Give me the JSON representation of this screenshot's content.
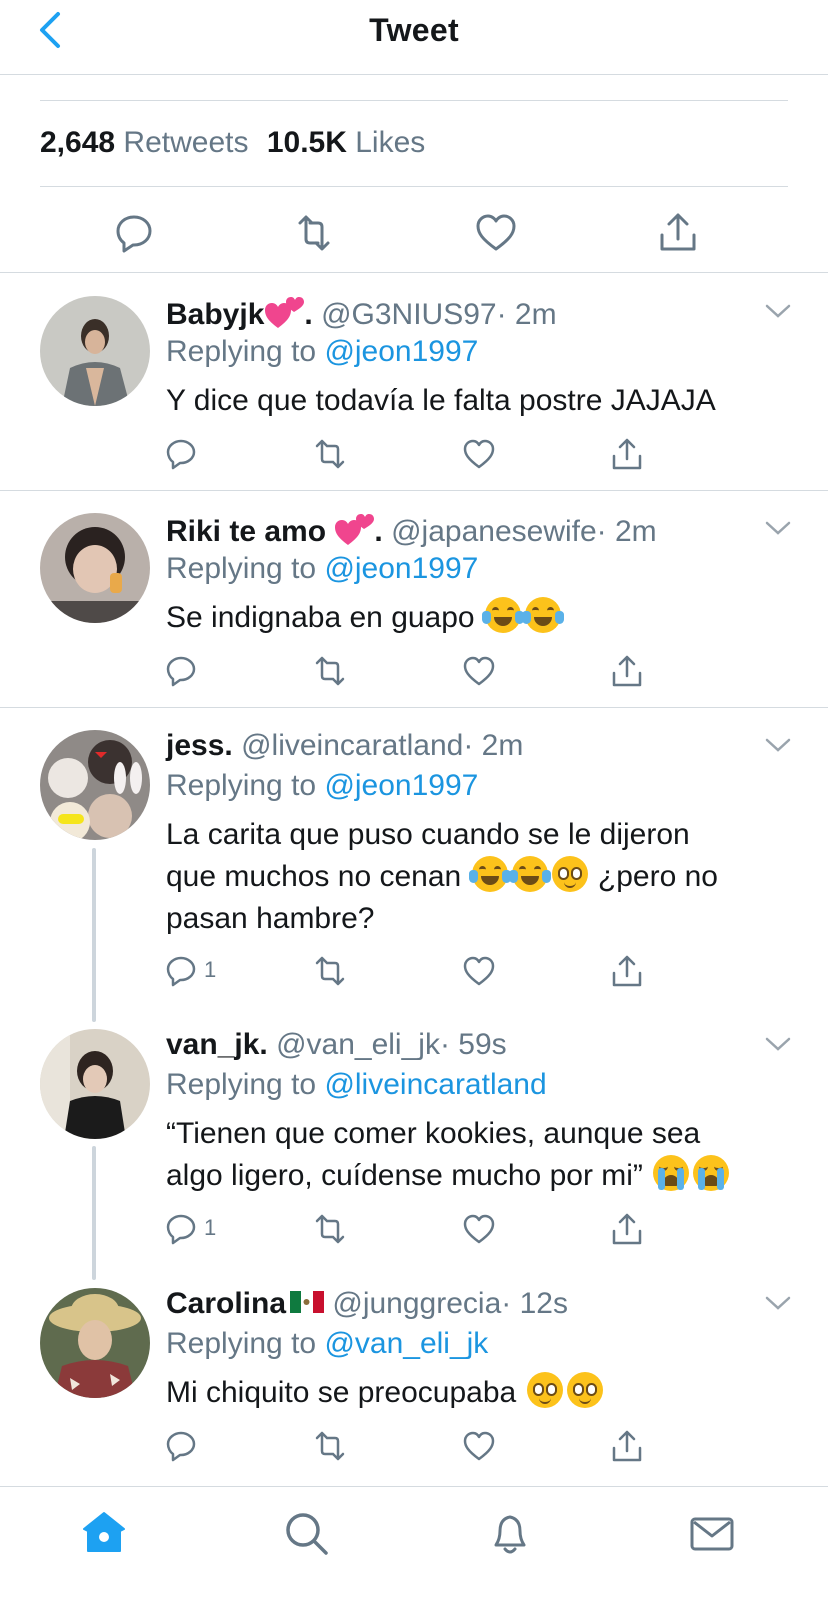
{
  "header": {
    "title": "Tweet",
    "back_icon": "chevron-left-icon"
  },
  "stats": {
    "retweets_count": "2,648",
    "retweets_label": "Retweets",
    "likes_count": "10.5K",
    "likes_label": "Likes"
  },
  "colors": {
    "accent": "#1da1f2",
    "link": "#1b95e0",
    "muted": "#657786",
    "divider": "#d5dbe0"
  },
  "replies": [
    {
      "name": "Babyjk",
      "name_suffix": ".",
      "handle": "@G3NIUS97",
      "time": "· 2m",
      "replying_prefix": "Replying to",
      "replying_to": "@jeon1997",
      "text": "Y dice que todavía le falta postre JAJAJA",
      "reply_count": ""
    },
    {
      "name": "Riki te amo",
      "name_suffix": ".",
      "handle": "@japanesewife",
      "time": "· 2m",
      "replying_prefix": "Replying to",
      "replying_to": "@jeon1997",
      "text": "Se indignaba en guapo",
      "reply_count": ""
    },
    {
      "name": "jess.",
      "handle": "@liveincaratland",
      "time": "· 2m",
      "replying_prefix": "Replying to",
      "replying_to": "@jeon1997",
      "text_line1": "La carita que puso cuando se le dijeron",
      "text_line2a": "que muchos no cenan",
      "text_line2b": "¿pero no",
      "text_line3": "pasan hambre?",
      "reply_count": "1"
    },
    {
      "name": "van_jk.",
      "handle": "@van_eli_jk",
      "time": "· 59s",
      "replying_prefix": "Replying to",
      "replying_to": "@liveincaratland",
      "text_line1": "“Tienen que comer kookies, aunque sea",
      "text_line2": "algo ligero, cuídense mucho por mi”",
      "reply_count": "1"
    },
    {
      "name": "Carolina",
      "handle": "@junggrecia",
      "time": "· 12s",
      "replying_prefix": "Replying to",
      "replying_to": "@van_eli_jk",
      "text": "Mi chiquito se preocupaba",
      "reply_count": ""
    }
  ],
  "tabbar": {
    "items": [
      "home-icon",
      "search-icon",
      "notifications-icon",
      "messages-icon"
    ]
  }
}
